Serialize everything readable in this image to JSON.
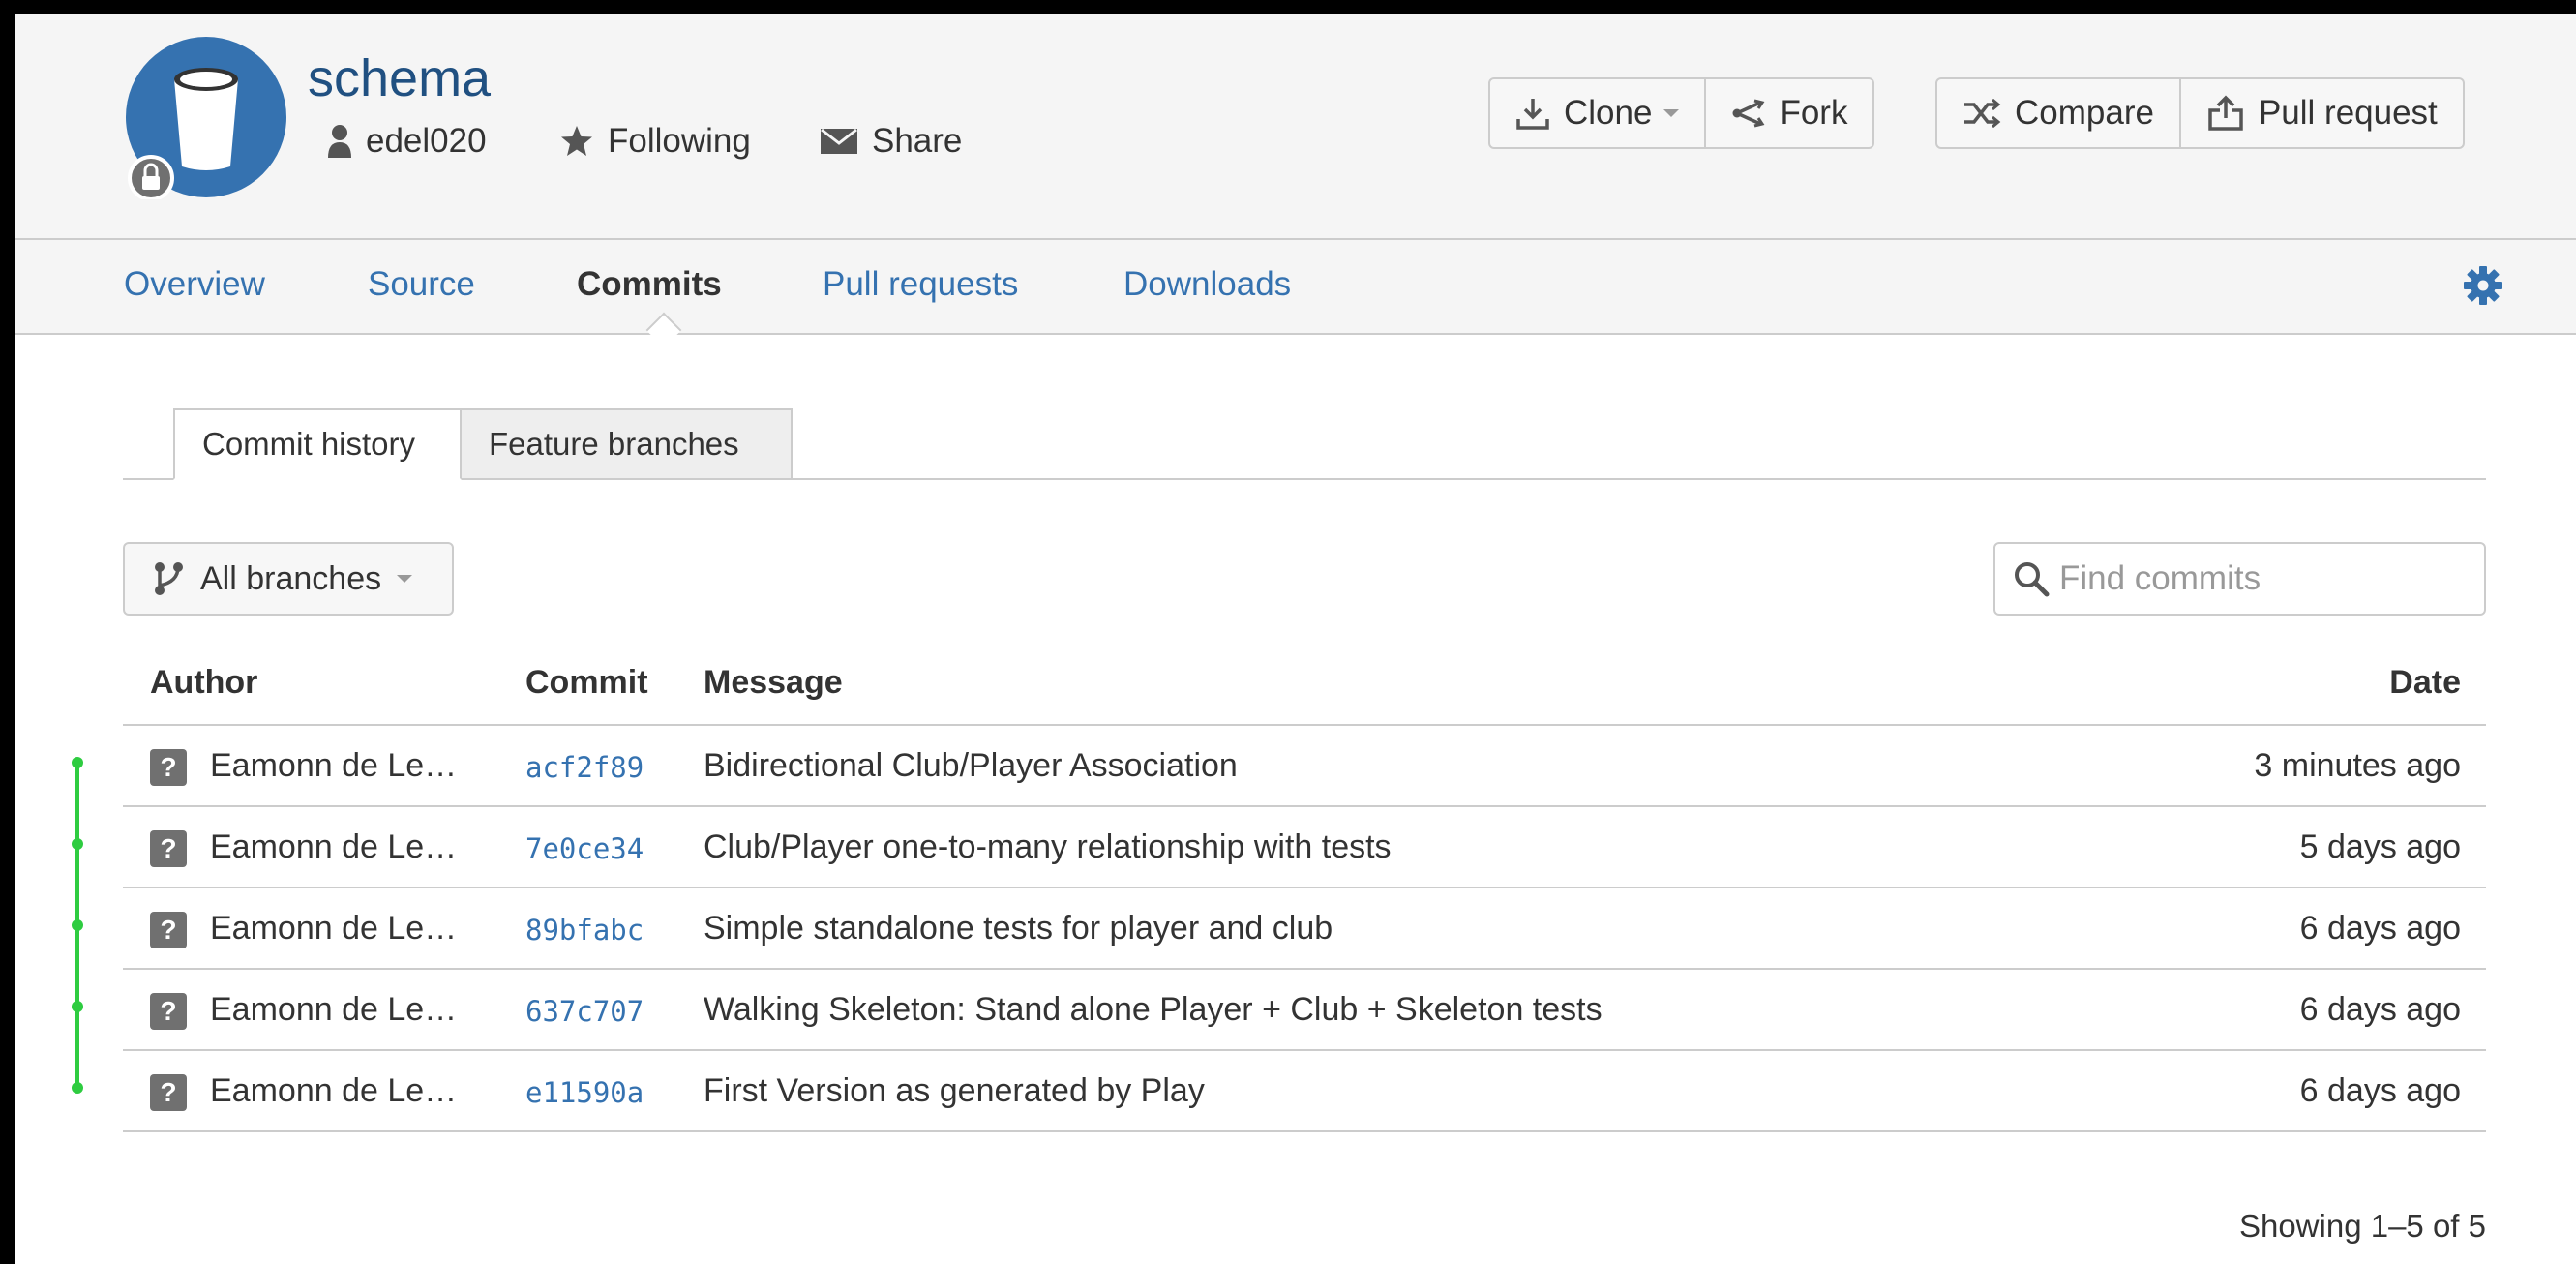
{
  "repo": {
    "name": "schema",
    "owner": "edel020",
    "follow_label": "Following",
    "share_label": "Share"
  },
  "actions": {
    "clone_label": "Clone",
    "fork_label": "Fork",
    "compare_label": "Compare",
    "pull_request_label": "Pull request"
  },
  "nav": {
    "items": [
      {
        "label": "Overview"
      },
      {
        "label": "Source"
      },
      {
        "label": "Commits",
        "active": true
      },
      {
        "label": "Pull requests"
      },
      {
        "label": "Downloads"
      }
    ]
  },
  "subtabs": [
    {
      "label": "Commit history",
      "active": true
    },
    {
      "label": "Feature branches"
    }
  ],
  "branch_filter": {
    "label": "All branches"
  },
  "search": {
    "placeholder": "Find commits",
    "value": ""
  },
  "table": {
    "headers": {
      "author": "Author",
      "commit": "Commit",
      "message": "Message",
      "date": "Date"
    },
    "rows": [
      {
        "avatar": "?",
        "author": "Eamonn de Le…",
        "hash": "acf2f89",
        "message": "Bidirectional Club/Player Association",
        "date": "3 minutes ago"
      },
      {
        "avatar": "?",
        "author": "Eamonn de Le…",
        "hash": "7e0ce34",
        "message": "Club/Player one-to-many relationship with tests",
        "date": "5 days ago"
      },
      {
        "avatar": "?",
        "author": "Eamonn de Le…",
        "hash": "89bfabc",
        "message": "Simple standalone tests for player and club",
        "date": "6 days ago"
      },
      {
        "avatar": "?",
        "author": "Eamonn de Le…",
        "hash": "637c707",
        "message": "Walking Skeleton: Stand alone Player + Club + Skeleton tests",
        "date": "6 days ago"
      },
      {
        "avatar": "?",
        "author": "Eamonn de Le…",
        "hash": "e11590a",
        "message": "First Version as generated by Play",
        "date": "6 days ago"
      }
    ]
  },
  "paging": {
    "label": "Showing 1–5 of 5"
  },
  "colors": {
    "link": "#3572b0",
    "title": "#205081",
    "graph": "#2ecc40",
    "avatar_bg": "#3572b0"
  },
  "icons": {
    "avatar": "bucket-icon",
    "private": "lock-icon",
    "owner": "user-icon",
    "follow": "star-icon",
    "share": "envelope-icon",
    "clone": "download-icon",
    "fork": "fork-icon",
    "compare": "compare-icon",
    "pull_request": "upload-icon",
    "settings": "gear-icon",
    "branches": "branch-icon",
    "search": "search-icon"
  }
}
